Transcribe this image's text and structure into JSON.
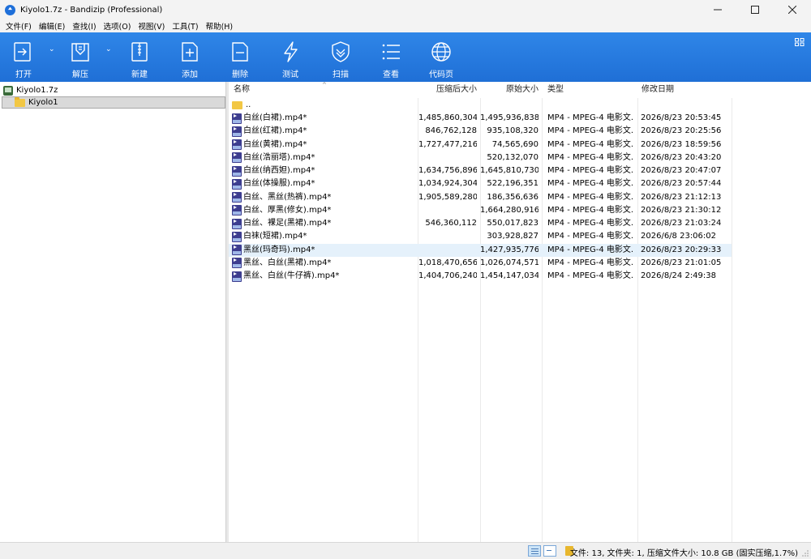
{
  "window": {
    "title": "Kiyolo1.7z - Bandizip (Professional)"
  },
  "menu": [
    "文件(F)",
    "编辑(E)",
    "查找(I)",
    "选项(O)",
    "视图(V)",
    "工具(T)",
    "帮助(H)"
  ],
  "toolbar": {
    "buttons": [
      {
        "label": "打开",
        "icon": "open-icon"
      },
      {
        "label": "解压",
        "icon": "extract-icon"
      },
      {
        "label": "新建",
        "icon": "new-archive-icon"
      },
      {
        "label": "添加",
        "icon": "add-file-icon"
      },
      {
        "label": "删除",
        "icon": "delete-file-icon"
      },
      {
        "label": "测试",
        "icon": "test-lightning-icon"
      },
      {
        "label": "扫描",
        "icon": "scan-shield-icon"
      },
      {
        "label": "查看",
        "icon": "view-list-icon"
      },
      {
        "label": "代码页",
        "icon": "codepage-globe-icon"
      }
    ],
    "color": "#2a7de1"
  },
  "tree": {
    "root": "Kiyolo1.7z",
    "child": "Kiyolo1"
  },
  "columns": {
    "name": "名称",
    "compressed": "压缩后大小",
    "original": "原始大小",
    "type": "类型",
    "modified": "修改日期"
  },
  "parent_entry": "..",
  "files": [
    {
      "name": "白丝(白裙).mp4*",
      "compressed": "1,485,860,304",
      "original": "1,495,936,838",
      "type": "MP4 - MPEG-4 电影文...",
      "modified": "2026/8/23 20:53:45"
    },
    {
      "name": "白丝(红裙).mp4*",
      "compressed": "846,762,128",
      "original": "935,108,320",
      "type": "MP4 - MPEG-4 电影文...",
      "modified": "2026/8/23 20:25:56"
    },
    {
      "name": "白丝(黄裙).mp4*",
      "compressed": "1,727,477,216",
      "original": "74,565,690",
      "type": "MP4 - MPEG-4 电影文...",
      "modified": "2026/8/23 18:59:56"
    },
    {
      "name": "白丝(浩丽塔).mp4*",
      "compressed": "",
      "original": "520,132,070",
      "type": "MP4 - MPEG-4 电影文...",
      "modified": "2026/8/23 20:43:20"
    },
    {
      "name": "白丝(纳西妲).mp4*",
      "compressed": "1,634,756,896",
      "original": "1,645,810,730",
      "type": "MP4 - MPEG-4 电影文...",
      "modified": "2026/8/23 20:47:07"
    },
    {
      "name": "白丝(体操服).mp4*",
      "compressed": "1,034,924,304",
      "original": "522,196,351",
      "type": "MP4 - MPEG-4 电影文...",
      "modified": "2026/8/23 20:57:44"
    },
    {
      "name": "白丝、黑丝(热裤).mp4*",
      "compressed": "1,905,589,280",
      "original": "186,356,636",
      "type": "MP4 - MPEG-4 电影文...",
      "modified": "2026/8/23 21:12:13"
    },
    {
      "name": "白丝、厚黑(修女).mp4*",
      "compressed": "",
      "original": "1,664,280,916",
      "type": "MP4 - MPEG-4 电影文...",
      "modified": "2026/8/23 21:30:12"
    },
    {
      "name": "白丝、裸足(黑裙).mp4*",
      "compressed": "546,360,112",
      "original": "550,017,823",
      "type": "MP4 - MPEG-4 电影文...",
      "modified": "2026/8/23 21:03:24"
    },
    {
      "name": "白袜(短裙).mp4*",
      "compressed": "",
      "original": "303,928,827",
      "type": "MP4 - MPEG-4 电影文...",
      "modified": "2026/6/8 23:06:02"
    },
    {
      "name": "黑丝(玛奇玛).mp4*",
      "compressed": "",
      "original": "1,427,935,776",
      "type": "MP4 - MPEG-4 电影文...",
      "modified": "2026/8/23 20:29:33",
      "selected": true
    },
    {
      "name": "黑丝、白丝(黑裙).mp4*",
      "compressed": "1,018,470,656",
      "original": "1,026,074,571",
      "type": "MP4 - MPEG-4 电影文...",
      "modified": "2026/8/23 21:01:05"
    },
    {
      "name": "黑丝、白丝(牛仔裤).mp4*",
      "compressed": "1,404,706,240",
      "original": "1,454,147,034",
      "type": "MP4 - MPEG-4 电影文...",
      "modified": "2026/8/24 2:49:38"
    }
  ],
  "status": {
    "text": "文件: 13, 文件夹: 1, 压缩文件大小: 10.8 GB (固实压缩,1.7%)"
  }
}
